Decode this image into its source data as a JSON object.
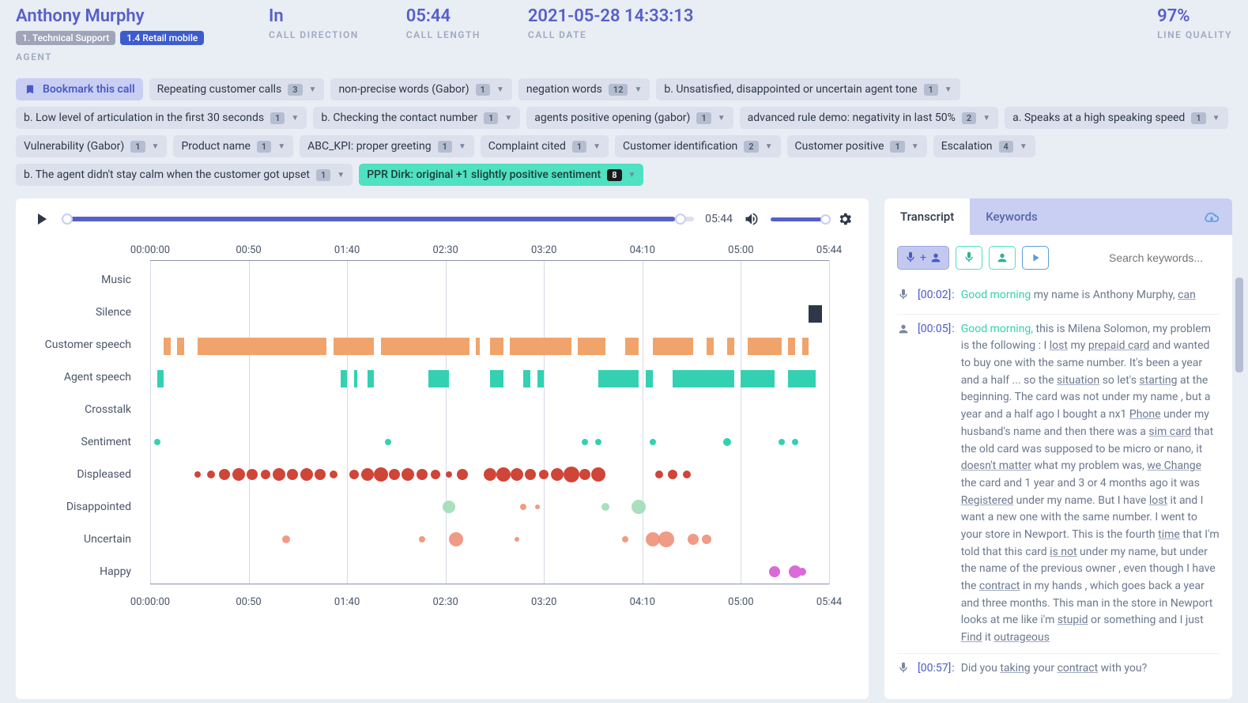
{
  "header": {
    "agent_name": "Anthony Murphy",
    "agent_tags": [
      {
        "label": "1. Technical Support",
        "cls": "tag-grey"
      },
      {
        "label": "1.4 Retail mobile",
        "cls": "tag-blue"
      }
    ],
    "agent_label": "AGENT",
    "direction_value": "In",
    "direction_label": "CALL DIRECTION",
    "length_value": "05:44",
    "length_label": "CALL LENGTH",
    "date_value": "2021-05-28 14:33:13",
    "date_label": "CALL DATE",
    "quality_value": "97%",
    "quality_label": "LINE QUALITY"
  },
  "bookmark_label": "Bookmark this call",
  "tags": [
    {
      "label": "Repeating customer calls",
      "count": "3"
    },
    {
      "label": "non-precise words (Gabor)",
      "count": "1"
    },
    {
      "label": "negation words",
      "count": "12"
    },
    {
      "label": "b. Unsatisfied, disappointed or uncertain agent tone",
      "count": "1"
    },
    {
      "label": "b. Low level of articulation in the first 30 seconds",
      "count": "1"
    },
    {
      "label": "b. Checking the contact number",
      "count": "1"
    },
    {
      "label": "agents positive opening (gabor)",
      "count": "1"
    },
    {
      "label": "advanced rule demo: negativity in last 50%",
      "count": "2"
    },
    {
      "label": "a. Speaks at a high speaking speed",
      "count": "1"
    },
    {
      "label": "Vulnerability (Gabor)",
      "count": "1"
    },
    {
      "label": "Product name",
      "count": "1"
    },
    {
      "label": "ABC_KPI: proper greeting",
      "count": "1"
    },
    {
      "label": "Complaint cited",
      "count": "1"
    },
    {
      "label": "Customer identification",
      "count": "2"
    },
    {
      "label": "Customer positive",
      "count": "1"
    },
    {
      "label": "Escalation",
      "count": "4"
    },
    {
      "label": "b. The agent didn't stay calm when the customer got upset",
      "count": "1"
    },
    {
      "label": "PPR Dirk: original +1 slightly positive sentiment",
      "count": "8",
      "style": "teal"
    }
  ],
  "player": {
    "position_pct": 100,
    "time": "05:44"
  },
  "chart_data": {
    "type": "timeline",
    "x_ticks": [
      "00:00:00",
      "00:50",
      "01:40",
      "02:30",
      "03:20",
      "04:10",
      "05:00",
      "05:44"
    ],
    "rows": [
      "Music",
      "Silence",
      "Customer speech",
      "Agent speech",
      "Crosstalk",
      "Sentiment",
      "Displeased",
      "Disappointed",
      "Uncertain",
      "Happy"
    ],
    "silence_bars": [
      [
        97,
        99
      ]
    ],
    "customer_bars": [
      [
        2,
        3
      ],
      [
        4,
        5
      ],
      [
        7,
        26
      ],
      [
        27,
        33
      ],
      [
        34,
        47
      ],
      [
        48,
        48.5
      ],
      [
        50,
        52
      ],
      [
        53,
        62
      ],
      [
        63,
        67
      ],
      [
        70,
        72
      ],
      [
        74,
        80
      ],
      [
        82,
        83
      ],
      [
        85,
        86
      ],
      [
        88,
        93
      ],
      [
        94,
        95
      ],
      [
        96,
        97
      ]
    ],
    "agent_bars": [
      [
        1,
        2
      ],
      [
        28,
        29
      ],
      [
        30,
        30.5
      ],
      [
        32,
        33
      ],
      [
        41,
        44
      ],
      [
        50,
        52
      ],
      [
        55,
        56
      ],
      [
        57,
        58
      ],
      [
        66,
        72
      ],
      [
        73,
        74
      ],
      [
        77,
        86
      ],
      [
        87,
        92
      ],
      [
        94,
        98
      ]
    ],
    "sentiment_dots": [
      {
        "x": 1,
        "size": 8,
        "cls": "dot-teal"
      },
      {
        "x": 35,
        "size": 8,
        "cls": "dot-teal"
      },
      {
        "x": 64,
        "size": 8,
        "cls": "dot-teal"
      },
      {
        "x": 66,
        "size": 8,
        "cls": "dot-teal"
      },
      {
        "x": 74,
        "size": 8,
        "cls": "dot-teal"
      },
      {
        "x": 85,
        "size": 10,
        "cls": "dot-teal"
      },
      {
        "x": 93,
        "size": 8,
        "cls": "dot-teal"
      },
      {
        "x": 95,
        "size": 8,
        "cls": "dot-teal"
      }
    ],
    "displeased_dots": [
      {
        "x": 7,
        "size": 8
      },
      {
        "x": 9,
        "size": 10
      },
      {
        "x": 11,
        "size": 14
      },
      {
        "x": 13,
        "size": 16
      },
      {
        "x": 15,
        "size": 14
      },
      {
        "x": 17,
        "size": 12
      },
      {
        "x": 19,
        "size": 16
      },
      {
        "x": 21,
        "size": 14
      },
      {
        "x": 23,
        "size": 16
      },
      {
        "x": 25,
        "size": 14
      },
      {
        "x": 27,
        "size": 10
      },
      {
        "x": 30,
        "size": 12
      },
      {
        "x": 32,
        "size": 16
      },
      {
        "x": 34,
        "size": 18
      },
      {
        "x": 36,
        "size": 14
      },
      {
        "x": 38,
        "size": 16
      },
      {
        "x": 40,
        "size": 14
      },
      {
        "x": 42,
        "size": 12
      },
      {
        "x": 44,
        "size": 8
      },
      {
        "x": 46,
        "size": 14
      },
      {
        "x": 50,
        "size": 16
      },
      {
        "x": 52,
        "size": 18
      },
      {
        "x": 54,
        "size": 16
      },
      {
        "x": 56,
        "size": 14
      },
      {
        "x": 58,
        "size": 12
      },
      {
        "x": 60,
        "size": 16
      },
      {
        "x": 62,
        "size": 20
      },
      {
        "x": 64,
        "size": 14
      },
      {
        "x": 66,
        "size": 18
      },
      {
        "x": 75,
        "size": 10
      },
      {
        "x": 77,
        "size": 12
      },
      {
        "x": 79,
        "size": 10
      }
    ],
    "disappointed_dots": [
      {
        "x": 44,
        "size": 16,
        "cls": "dot-lgreen"
      },
      {
        "x": 55,
        "size": 8,
        "cls": "dot-lred"
      },
      {
        "x": 57,
        "size": 6,
        "cls": "dot-lred"
      },
      {
        "x": 67,
        "size": 10,
        "cls": "dot-lgreen"
      },
      {
        "x": 72,
        "size": 18,
        "cls": "dot-lgreen"
      }
    ],
    "uncertain_dots": [
      {
        "x": 20,
        "size": 10,
        "cls": "dot-lred"
      },
      {
        "x": 40,
        "size": 8,
        "cls": "dot-lred"
      },
      {
        "x": 45,
        "size": 18,
        "cls": "dot-lred"
      },
      {
        "x": 54,
        "size": 6,
        "cls": "dot-lred"
      },
      {
        "x": 70,
        "size": 8,
        "cls": "dot-lred"
      },
      {
        "x": 74,
        "size": 18,
        "cls": "dot-lred"
      },
      {
        "x": 76,
        "size": 20,
        "cls": "dot-lred"
      },
      {
        "x": 80,
        "size": 14,
        "cls": "dot-lred"
      },
      {
        "x": 82,
        "size": 12,
        "cls": "dot-lred"
      }
    ],
    "happy_dots": [
      {
        "x": 95,
        "size": 16,
        "cls": "dot-pink"
      },
      {
        "x": 92,
        "size": 14,
        "cls": "dot-pink"
      },
      {
        "x": 96,
        "size": 10,
        "cls": "dot-pink"
      }
    ]
  },
  "right": {
    "tab_transcript": "Transcript",
    "tab_keywords": "Keywords",
    "search_placeholder": "Search keywords...",
    "lines": [
      {
        "who": "agent",
        "time": "[00:02]",
        "html": "<span class='kw'>Good morning</span> my name is Anthony Murphy, <span class='ul'>can</span>"
      },
      {
        "who": "customer",
        "time": "[00:05]",
        "html": "<span class='kw'>Good morning,</span> this is Milena Solomon, my problem is the following : I <span class='ul'>lost</span> my <span class='ul'>prepaid card</span> and wanted to buy one with the same number. It's been a year and a half ... so the <span class='ul'>situation</span> so let's <span class='ul'>starting</span> at the beginning. The card was not under my name , but a year and a half ago I bought a nx1 <span class='ul'>Phone</span> under my husband's name and then there was a <span class='ul'>sim card</span> that the old card was supposed to be micro or nano, it <span class='ul'>doesn't matter</span> what my problem was, <span class='ul'>we Change</span> the card and 1 year and 3 or 4 months ago it was <span class='ul'>Registered</span> under my name. But I have <span class='ul'>lost</span> it and I want a new one with the same number. I went to your store in Newport. This is the fourth <span class='ul'>time</span> that I'm told that this card <span class='ul'>is not</span> under my name, but under the name of the previous owner , even though I have the <span class='ul'>contract</span> in my hands , which goes back a year and three months. This man in the store in Newport looks at me like i'm <span class='ul'>stupid</span> or something and I just <span class='ul'>Find</span> it <span class='ul'>outrageous</span>"
      },
      {
        "who": "agent",
        "time": "[00:57]",
        "html": "Did you <span class='ul'>taking</span> your <span class='ul'>contract</span> with you?"
      }
    ]
  }
}
